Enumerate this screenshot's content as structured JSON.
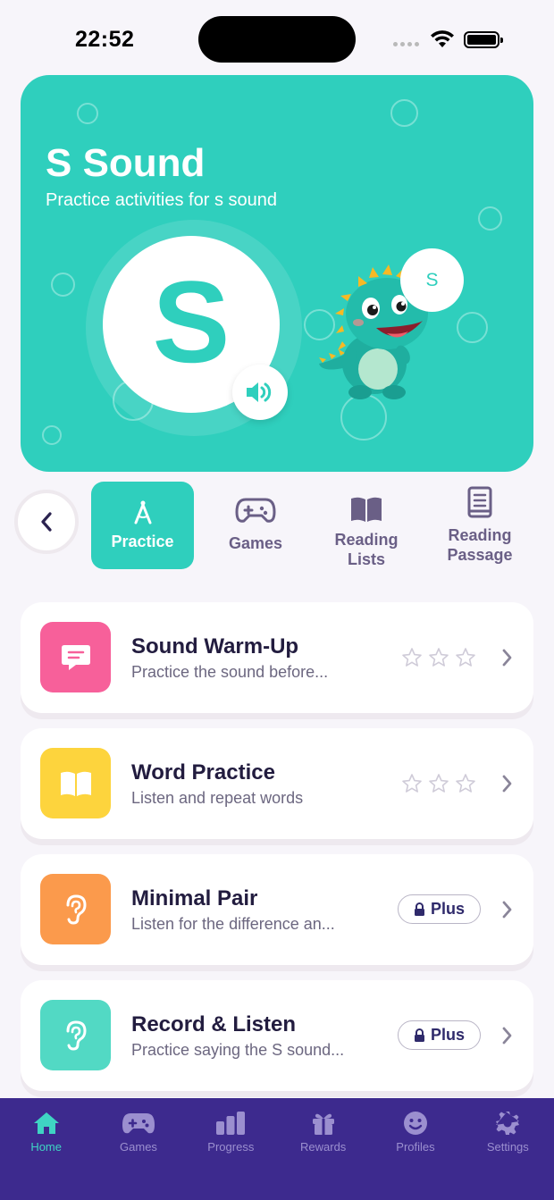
{
  "status_bar": {
    "time": "22:52"
  },
  "hero": {
    "title": "S Sound",
    "subtitle": "Practice activities for s sound",
    "letter": "S",
    "speech_letter": "S"
  },
  "tabs": [
    {
      "label": "Practice",
      "icon": "compass-icon",
      "active": true
    },
    {
      "label": "Games",
      "icon": "gamepad-icon",
      "active": false
    },
    {
      "label": "Reading Lists",
      "icon": "book-open-icon",
      "active": false
    },
    {
      "label": "Reading Passage",
      "icon": "book-icon",
      "active": false
    }
  ],
  "activities": [
    {
      "title": "Sound Warm-Up",
      "description": "Practice the sound before...",
      "color": "#f7609a",
      "icon": "chat-bubble-icon",
      "stars": 0,
      "badge": null
    },
    {
      "title": "Word Practice",
      "description": "Listen and repeat words",
      "color": "#fdd43d",
      "icon": "book-icon",
      "stars": 0,
      "badge": null
    },
    {
      "title": "Minimal Pair",
      "description": "Listen for the difference an...",
      "color": "#fb9a4c",
      "icon": "ear-icon",
      "stars": null,
      "badge": "Plus"
    },
    {
      "title": "Record & Listen",
      "description": "Practice saying the S sound...",
      "color": "#52d9c4",
      "icon": "ear-icon",
      "stars": null,
      "badge": "Plus"
    }
  ],
  "bottom_nav": [
    {
      "label": "Home",
      "icon": "home-icon",
      "active": true
    },
    {
      "label": "Games",
      "icon": "gamepad-icon",
      "active": false
    },
    {
      "label": "Progress",
      "icon": "bar-chart-icon",
      "active": false
    },
    {
      "label": "Rewards",
      "icon": "gift-icon",
      "active": false
    },
    {
      "label": "Profiles",
      "icon": "smiley-icon",
      "active": false
    },
    {
      "label": "Settings",
      "icon": "gear-icon",
      "active": false
    }
  ],
  "colors": {
    "accent": "#2fcfbd",
    "nav_bg": "#3d2a8e",
    "nav_active": "#3fd4c3",
    "nav_inactive": "#9b8fcf"
  }
}
